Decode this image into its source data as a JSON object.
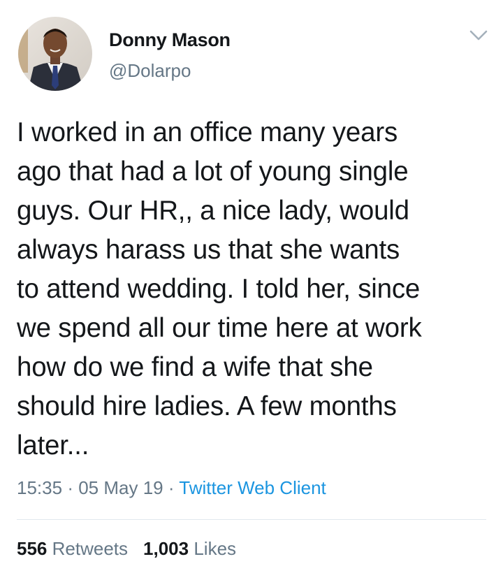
{
  "tweet": {
    "author_name": "Donny Mason",
    "author_handle": "@Dolarpo",
    "text": "I worked in an office many years\nago that had a lot of young single\nguys. Our HR,, a nice lady, would\nalways harass us that she wants\nto attend wedding. I told her, since\nwe spend all our time here at work\nhow do we find a wife that she\nshould hire ladies. A few months\nlater...",
    "time": "15:35",
    "date": "05 May 19",
    "separator": "·",
    "client": "Twitter Web Client"
  },
  "stats": {
    "retweets_count": "556",
    "retweets_label": "Retweets",
    "likes_count": "1,003",
    "likes_label": "Likes"
  },
  "icons": {
    "menu": "chevron-down-icon",
    "avatar": "profile-photo"
  },
  "colors": {
    "text": "#14171a",
    "secondary": "#657786",
    "link": "#1b95e0",
    "divider": "#e1e8ed"
  }
}
